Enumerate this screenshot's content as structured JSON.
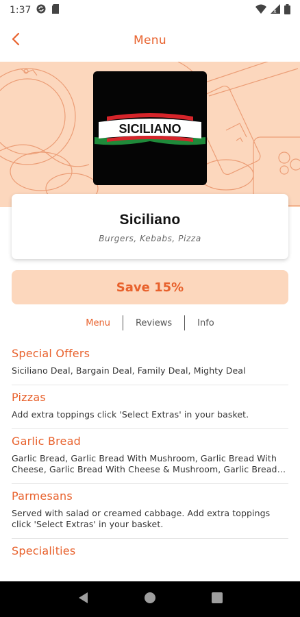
{
  "status_bar": {
    "time": "1:37",
    "icons": [
      "sync-icon",
      "sd-card-icon",
      "wifi-icon",
      "signal-icon",
      "battery-icon"
    ]
  },
  "header": {
    "title": "Menu",
    "back_icon": "chevron-left-icon"
  },
  "restaurant": {
    "logo_text": "SICILIANO",
    "name": "Siciliano",
    "cuisine": "Burgers, Kebabs, Pizza"
  },
  "promo": {
    "label": "Save 15%"
  },
  "tabs": [
    {
      "label": "Menu",
      "active": true
    },
    {
      "label": "Reviews",
      "active": false
    },
    {
      "label": "Info",
      "active": false
    }
  ],
  "menu": [
    {
      "title": "Special Offers",
      "description": "Siciliano Deal, Bargain Deal, Family Deal, Mighty Deal"
    },
    {
      "title": "Pizzas",
      "description": "Add extra toppings click 'Select Extras' in your basket."
    },
    {
      "title": "Garlic Bread",
      "description": "Garlic Bread, Garlic Bread With Mushroom, Garlic Bread With Cheese, Garlic Bread With Cheese & Mushroom, Garlic Bread With Cheese & Onion"
    },
    {
      "title": "Parmesans",
      "description": "Served with salad or creamed cabbage. Add extra toppings click 'Select Extras' in your basket."
    },
    {
      "title": "Specialities",
      "description": ""
    }
  ],
  "colors": {
    "accent": "#e8612c",
    "peach": "#fcd7bd",
    "nav_bar": "#000000"
  },
  "nav_icons": [
    "back-triangle-icon",
    "home-circle-icon",
    "recents-square-icon"
  ]
}
